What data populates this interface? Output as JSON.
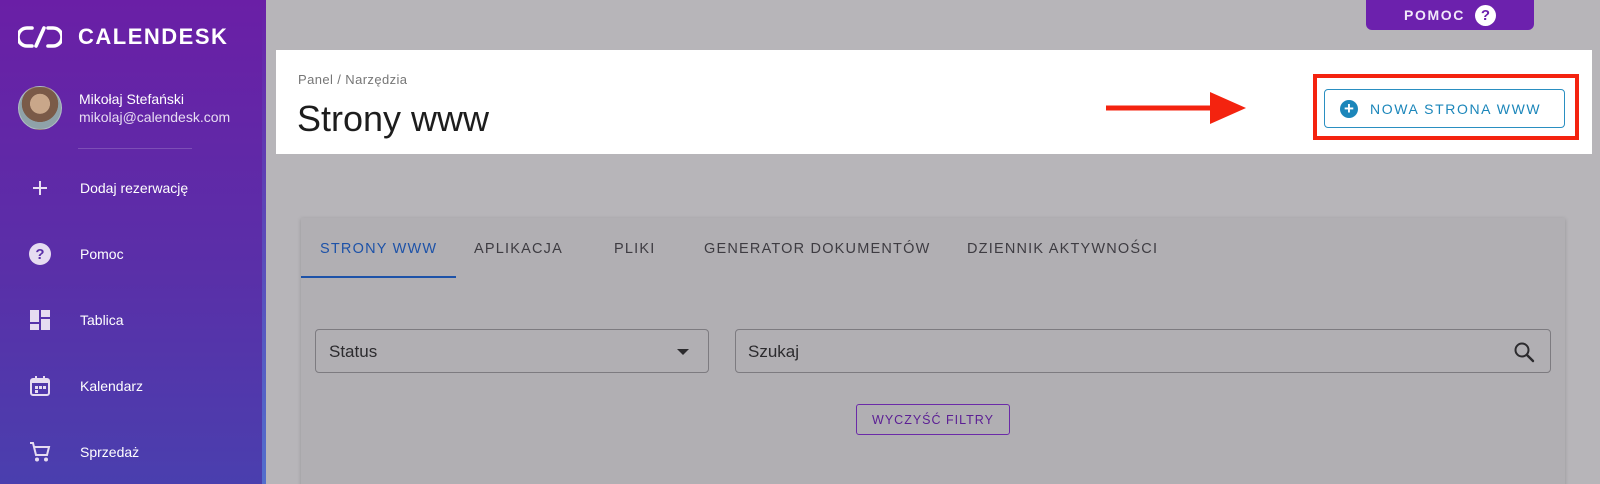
{
  "brand": {
    "name": "CALENDESK"
  },
  "user": {
    "name": "Mikołaj Stefański",
    "email": "mikolaj@calendesk.com"
  },
  "sidebar": {
    "items": [
      {
        "label": "Dodaj rezerwację",
        "icon": "plus-icon"
      },
      {
        "label": "Pomoc",
        "icon": "help-circle-icon"
      },
      {
        "label": "Tablica",
        "icon": "dashboard-icon"
      },
      {
        "label": "Kalendarz",
        "icon": "calendar-icon"
      },
      {
        "label": "Sprzedaż",
        "icon": "cart-icon"
      }
    ]
  },
  "help_button": {
    "label": "POMOC",
    "icon": "question-icon"
  },
  "header": {
    "breadcrumb": "Panel / Narzędzia",
    "title": "Strony www",
    "new_button_label": "NOWA STRONA WWW"
  },
  "tabs": [
    {
      "label": "STRONY WWW",
      "active": true
    },
    {
      "label": "APLIKACJA",
      "active": false
    },
    {
      "label": "PLIKI",
      "active": false
    },
    {
      "label": "GENERATOR DOKUMENTÓW",
      "active": false
    },
    {
      "label": "DZIENNIK AKTYWNOŚCI",
      "active": false
    }
  ],
  "filters": {
    "status_label": "Status",
    "search_placeholder": "Szukaj",
    "clear_label": "WYCZYŚĆ FILTRY"
  },
  "colors": {
    "sidebar_top": "#6a1fa6",
    "sidebar_bottom": "#4a3fae",
    "accent_blue": "#1b86ba",
    "tab_active": "#1d52a8",
    "highlight_red": "#f4230f",
    "purple": "#6c21ad"
  }
}
